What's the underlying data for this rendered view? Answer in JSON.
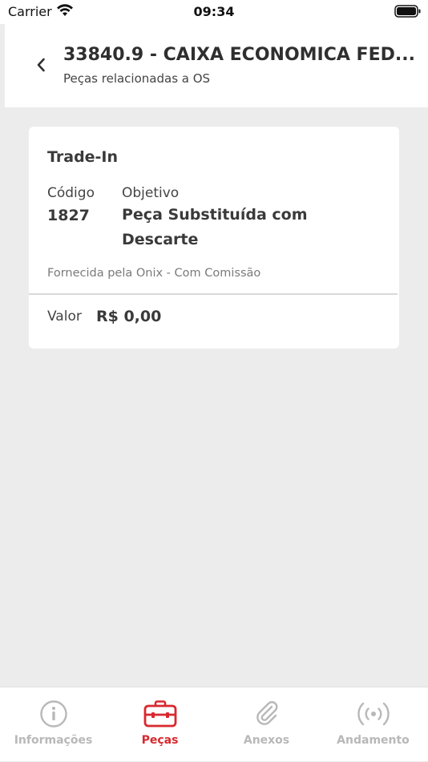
{
  "status_bar": {
    "carrier": "Carrier",
    "time": "09:34"
  },
  "header": {
    "title": "33840.9 - CAIXA ECONOMICA FED...",
    "subtitle": "Peças relacionadas a OS"
  },
  "card": {
    "type": "Trade-In",
    "codigo_label": "Código",
    "codigo_value": "1827",
    "objetivo_label": "Objetivo",
    "objetivo_value": "Peça Substituída com Descarte",
    "fornecida": "Fornecida pela Onix - Com Comissão",
    "valor_label": "Valor",
    "valor_value": "R$ 0,00"
  },
  "tabs": [
    {
      "label": "Informações",
      "icon": "info-icon",
      "active": false
    },
    {
      "label": "Peças",
      "icon": "toolbox-icon",
      "active": true
    },
    {
      "label": "Anexos",
      "icon": "paperclip-icon",
      "active": false
    },
    {
      "label": "Andamento",
      "icon": "broadcast-icon",
      "active": false
    }
  ],
  "colors": {
    "accent": "#d8282e",
    "inactive_tab": "#b8b8b8",
    "background": "#ececec"
  }
}
